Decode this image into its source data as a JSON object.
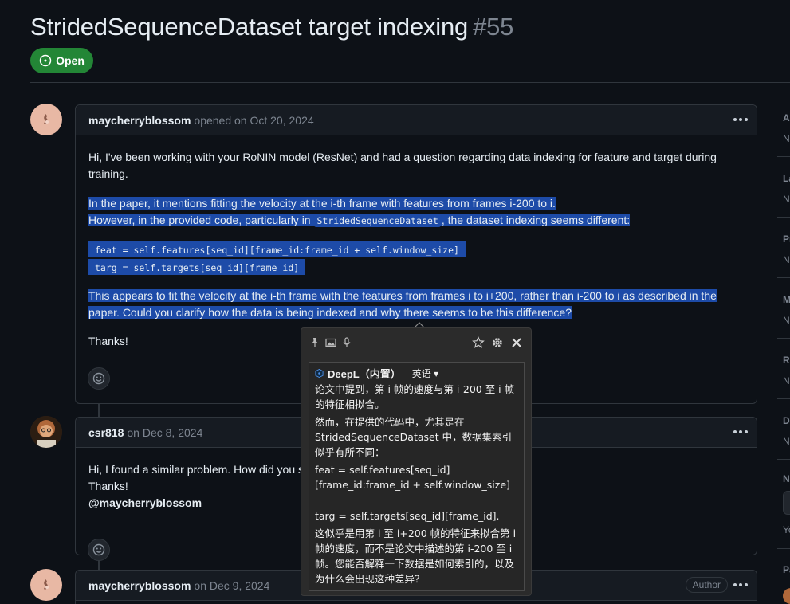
{
  "issue": {
    "title": "StridedSequenceDataset target indexing",
    "number": "#55",
    "state": "Open"
  },
  "comments": [
    {
      "author": "maycherryblossom",
      "meta": "opened on Oct 20, 2024",
      "para1": "Hi, I've been working with your RoNIN model (ResNet) and had a question regarding data indexing for feature and target during training.",
      "hl_line1": "In the paper, it mentions fitting the velocity at the i-th frame with features from frames i-200 to i.",
      "hl_line2a": "However, in the provided code, particularly in ",
      "hl_code": "StridedSequenceDataset",
      "hl_line2b": ", the dataset indexing seems different:",
      "code1": "feat = self.features[seq_id][frame_id:frame_id + self.window_size]",
      "code2": "targ = self.targets[seq_id][frame_id]",
      "hl_para": "This appears to fit the velocity at the i-th frame with the features from frames i to i+200, rather than i-200 to i as described in the paper. Could you clarify how the data is being indexed and why there seems to be this difference?",
      "thanks": "Thanks!"
    },
    {
      "author": "csr818",
      "meta": "on Dec 8, 2024",
      "line1": "Hi, I found a similar problem. How did you s",
      "line2": "Thanks!",
      "mention": "@maycherryblossom"
    },
    {
      "author": "maycherryblossom",
      "meta": "on Dec 9, 2024",
      "badge": "Author"
    }
  ],
  "sidebar": {
    "letters": [
      "A",
      "N",
      "La",
      "N",
      "Pr",
      "N",
      "M",
      "N",
      "Re",
      "N",
      "D",
      "N",
      "N",
      "Yo",
      "Pa"
    ]
  },
  "popup": {
    "engine": "DeepL（内置）",
    "language": "英语",
    "p1": "论文中提到，第 i 帧的速度与第 i-200 至 i 帧的特征相拟合。",
    "p2": "然而，在提供的代码中，尤其是在 StridedSequenceDataset 中，数据集索引似乎有所不同：",
    "p3": "feat = self.features[seq_id][frame_id:frame_id + self.window_size]",
    "p4": "targ = self.targets[seq_id][frame_id].",
    "p5": "这似乎是用第 i 至 i+200 帧的特征来拟合第 i 帧的速度，而不是论文中描述的第 i-200 至 i 帧。您能否解释一下数据是如何索引的，以及为什么会出现这种差异？"
  },
  "colors": {
    "background": "#0d1117",
    "open_badge": "#238636",
    "selection": "#1d4ba8",
    "border": "#30363d"
  }
}
